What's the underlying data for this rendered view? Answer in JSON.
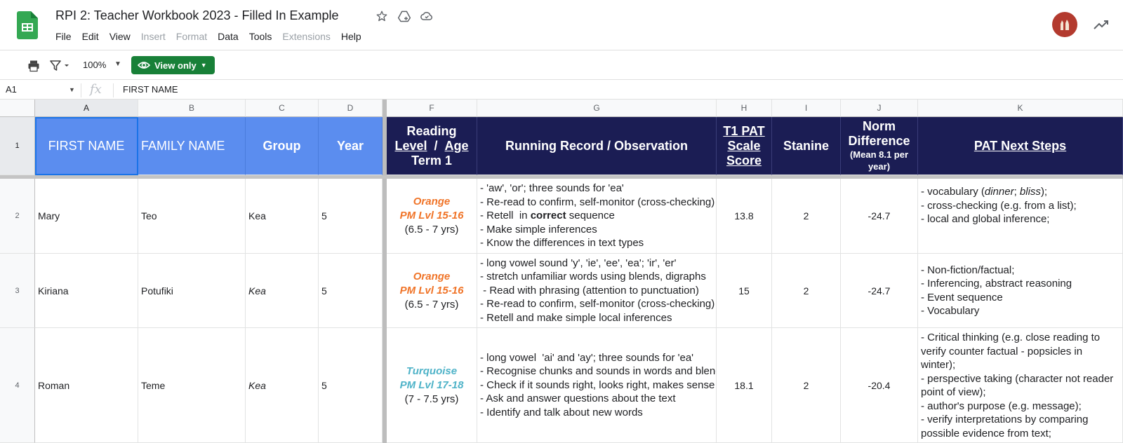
{
  "app": {
    "title": "RPI 2: Teacher Workbook 2023 - Filled In Example",
    "menu": [
      {
        "label": "File",
        "enabled": true
      },
      {
        "label": "Edit",
        "enabled": true
      },
      {
        "label": "View",
        "enabled": true
      },
      {
        "label": "Insert",
        "enabled": false
      },
      {
        "label": "Format",
        "enabled": false
      },
      {
        "label": "Data",
        "enabled": true
      },
      {
        "label": "Tools",
        "enabled": true
      },
      {
        "label": "Extensions",
        "enabled": false
      },
      {
        "label": "Help",
        "enabled": true
      }
    ],
    "title_icons": [
      "star-icon",
      "move-to-drive-icon",
      "cloud-status-icon"
    ],
    "avatar_color": "#b33a2e"
  },
  "toolbar": {
    "zoom": "100%",
    "view_only_label": "View only",
    "view_only_color": "#188038"
  },
  "formula_bar": {
    "cell_ref": "A1",
    "fx_label": "fx",
    "content": "FIRST NAME"
  },
  "sheet": {
    "columns": [
      "A",
      "B",
      "C",
      "D",
      "F",
      "G",
      "H",
      "I",
      "J",
      "K"
    ],
    "rows": [
      "1",
      "2",
      "3",
      "4"
    ],
    "header": {
      "first_name": "FIRST NAME",
      "family_name": "FAMILY NAME",
      "group": "Group",
      "year": "Year",
      "reading_1": "Reading",
      "reading_level": "Level",
      "reading_slash": "/",
      "reading_age": "Age",
      "reading_term": "Term 1",
      "running_record": "Running Record / Observation",
      "pat_1": "T1 PAT",
      "pat_2": "Scale",
      "pat_3": "Score",
      "stanine": "Stanine",
      "norm_1": "Norm",
      "norm_2": "Difference",
      "norm_3": "(Mean 8.1 per",
      "norm_4": "year)",
      "next_steps": "PAT Next Steps"
    },
    "students": [
      {
        "first": "Mary",
        "family": "Teo",
        "group": "Kea",
        "year": "5",
        "level_name": "Orange",
        "level_pm": "PM Lvl 15-16",
        "level_age": "(6.5 - 7 yrs)",
        "notes": [
          "- 'aw', 'or'; three sounds for 'ea'",
          "- Re-read to confirm, self-monitor (cross-checking)",
          "- Retell  in ",
          "correct",
          " sequence",
          "- Make simple inferences",
          "- Know the differences in text types"
        ],
        "pat": "13.8",
        "stanine": "2",
        "norm": "-24.7",
        "steps_1a": "- vocabulary (",
        "steps_1b": "dinner",
        "steps_1c": "; ",
        "steps_1d": "bliss",
        "steps_1e": ");",
        "steps": [
          "- cross-checking (e.g. from a list);",
          "- local and global inference;"
        ]
      },
      {
        "first": "Kiriana",
        "family": "Potufiki",
        "group": "Kea",
        "year": "5",
        "level_name": "Orange",
        "level_pm": "PM Lvl 15-16",
        "level_age": "(6.5 - 7 yrs)",
        "notes": [
          "- long vowel sound 'y', 'ie', 'ee', 'ea'; 'ir', 'er'",
          "- stretch unfamiliar words using blends, digraphs",
          " - Read with phrasing (attention to punctuation)",
          "- Re-read to confirm, self-monitor (cross-checking)",
          "- Retell and make simple local inferences"
        ],
        "pat": "15",
        "stanine": "2",
        "norm": "-24.7",
        "steps": [
          "- Non-fiction/factual;",
          "- Inferencing, abstract reasoning",
          "- Event sequence",
          "- Vocabulary"
        ]
      },
      {
        "first": "Roman",
        "family": "Teme",
        "group": "Kea",
        "year": "5",
        "level_name": "Turquoise",
        "level_pm": "PM Lvl 17-18",
        "level_age": "(7 - 7.5 yrs)",
        "notes": [
          "- long vowel  'ai' and 'ay'; three sounds for 'ea'",
          "- Recognise chunks and sounds in words and blends",
          "- Check if it sounds right, looks right, makes sense",
          "- Ask and answer questions about the text",
          "- Identify and talk about new words"
        ],
        "pat": "18.1",
        "stanine": "2",
        "norm": "-20.4",
        "steps": [
          "- Critical thinking (e.g. close reading to verify counter factual - popsicles in winter);",
          "- perspective taking (character not reader point of view);",
          "- author's purpose (e.g. message);",
          "- verify interpretations by comparing possible evidence from text;"
        ]
      }
    ]
  },
  "colors": {
    "header_blue": "#5b8def",
    "header_navy": "#1b1d54",
    "orange_level": "#f07428",
    "turquoise_level": "#4fb3c8"
  }
}
